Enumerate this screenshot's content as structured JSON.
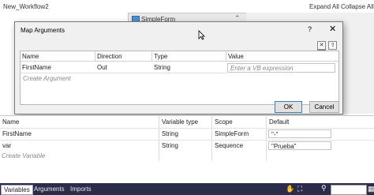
{
  "workflow": {
    "title": "New_Workflow2",
    "expand_all": "Expand All",
    "collapse_all": "Collapse All",
    "activity_name": "SimpleForm"
  },
  "dialog": {
    "title": "Map Arguments",
    "help": "?",
    "close": "✕",
    "toolbar": {
      "delete": "✕",
      "up": "⇧",
      "down": "⇩"
    },
    "columns": [
      "Name",
      "Direction",
      "Type",
      "Value"
    ],
    "rows": [
      {
        "name": "FirstName",
        "direction": "Out",
        "type": "String",
        "value_placeholder": "Enter a VB expression"
      }
    ],
    "create_argument": "Create Argument",
    "ok_label": "OK",
    "cancel_label": "Cancel"
  },
  "variables": {
    "columns": [
      "Name",
      "Variable type",
      "Scope",
      "Default"
    ],
    "rows": [
      {
        "name": "FirstName",
        "type": "String",
        "scope": "SimpleForm",
        "default": "\"-\""
      },
      {
        "name": "var",
        "type": "String",
        "scope": "Sequence",
        "default": "\"Prueba\""
      }
    ],
    "create_variable": "Create Variable"
  },
  "tabs": [
    "Variables",
    "Arguments",
    "Imports"
  ],
  "icons": {
    "hand": "hand-icon",
    "fit": "fit-screen-icon",
    "zoom": "zoom-icon",
    "overview": "overview-icon"
  },
  "colors": {
    "tabbar": "#2b2b4a",
    "ok_border": "#3c7fb1",
    "dialog_bg": "#f0f0f0"
  }
}
